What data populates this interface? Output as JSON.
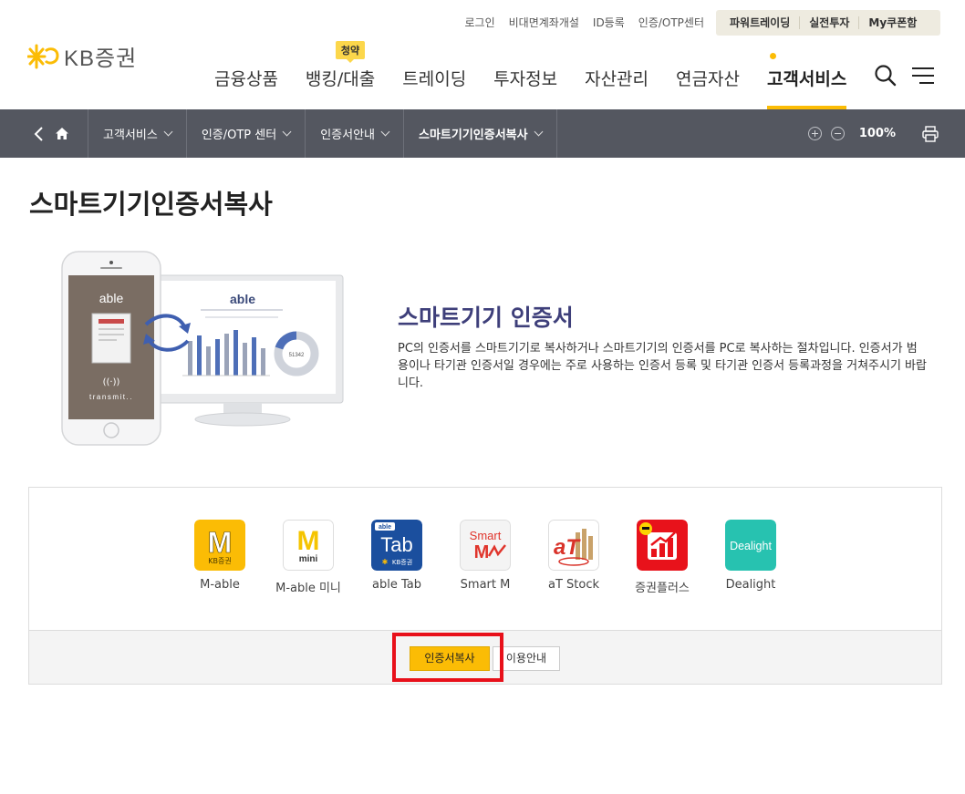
{
  "header": {
    "logo_text": "KB증권",
    "util_links": [
      "로그인",
      "비대면계좌개설",
      "ID등록",
      "인증/OTP센터"
    ],
    "util_box": [
      "파워트레이딩",
      "실전투자",
      "My쿠폰함"
    ],
    "gnb": [
      "금융상품",
      "뱅킹/대출",
      "트레이딩",
      "투자정보",
      "자산관리",
      "연금자산",
      "고객서비스"
    ],
    "gnb_badge": "청약",
    "active_menu": "고객서비스",
    "accent_color": "#fbbc05"
  },
  "location": {
    "items": [
      "고객서비스",
      "인증/OTP 센터",
      "인증서안내",
      "스마트기기인증서복사"
    ],
    "zoom": "100%",
    "bar_color": "#545760"
  },
  "page": {
    "title": "스마트기기인증서복사",
    "intro_title": "스마트기기 인증서",
    "intro_desc": "PC의 인증서를 스마트기기로 복사하거나 스마트기기의 인증서를 PC로 복사하는 절차입니다. 인증서가 범용이나 타기관 인증서일 경우에는 주로 사용하는 인증서 등록 및 타기관 인증서 등록과정을 거쳐주시기 바랍니다."
  },
  "illustration": {
    "phone_brand": "able",
    "phone_caption": "transmit..",
    "monitor_brand": "able",
    "donut_label": "51342"
  },
  "apps": [
    {
      "label": "M-able",
      "icon": "m-able-icon"
    },
    {
      "label": "M-able 미니",
      "icon": "m-able-mini-icon"
    },
    {
      "label": "able Tab",
      "icon": "able-tab-icon"
    },
    {
      "label": "Smart M",
      "icon": "smart-m-icon"
    },
    {
      "label": "aT Stock",
      "icon": "at-stock-icon"
    },
    {
      "label": "증권플러스",
      "icon": "stock-plus-icon"
    },
    {
      "label": "Dealight",
      "icon": "dealight-icon"
    }
  ],
  "app_icon_text": {
    "m_able": "M",
    "m_able_sub": "KB증권",
    "mini_m": "M",
    "mini_sub": "mini",
    "tab_top": "able",
    "tab_main": "Tab",
    "tab_sub": "KB증권",
    "smart": "Smart",
    "smart_m": "M",
    "at_stock": "aT",
    "dealight": "Dealight"
  },
  "buttons": {
    "copy": "인증서복사",
    "guide": "이용안내"
  }
}
